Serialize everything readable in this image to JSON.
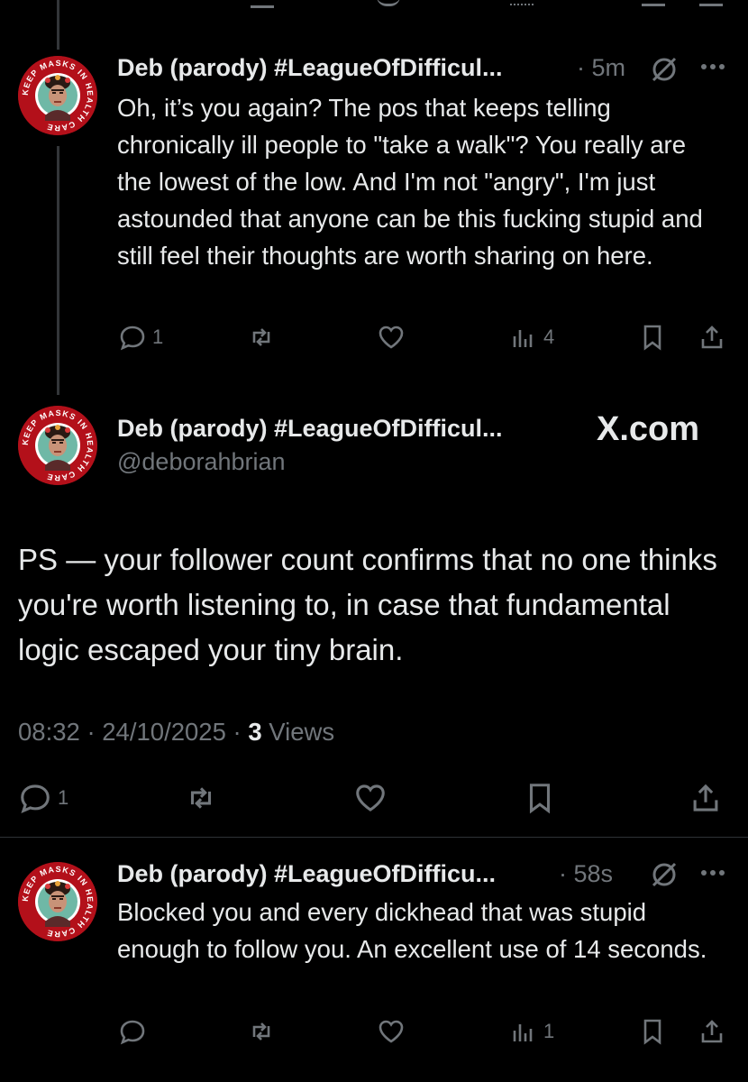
{
  "reply1": {
    "name": "Deb (parody) #LeagueOfDifficul...",
    "time": "· 5m",
    "text": "Oh, it’s you again? The pos that keeps telling chronically ill people to \"take a walk\"? You really are the lowest of the low. And I'm not \"angry\", I'm just astounded that anyone can be this fucking stupid and still feel their thoughts are worth sharing on here.",
    "reply_count": "1",
    "views_count": "4"
  },
  "main_post": {
    "name": "Deb (parody) #LeagueOfDifficul...",
    "handle": "@deborahbrian",
    "watermark": "X.com",
    "text": "PS — your follower count confirms that no one thinks you're worth listening to, in case that fundamental logic escaped your tiny brain.",
    "time": "08:32 · 24/10/2025 ·",
    "views_num": "3",
    "views_label": " Views",
    "reply_count": "1"
  },
  "reply2": {
    "name": "Deb (parody) #LeagueOfDifficu...",
    "time": "· 58s",
    "text": "Blocked you and every dickhead that was stupid enough to follow you. An excellent use of 14 seconds.",
    "views_count": "1"
  },
  "avatar": {
    "ring_text": "KEEP MASKS IN HEALTH CARE",
    "ring_color": "#b3101a"
  },
  "icons": [
    "reply-icon",
    "repost-icon",
    "like-icon",
    "views-icon",
    "bookmark-icon",
    "share-icon",
    "more-icon",
    "muted-icon"
  ],
  "colors": {
    "background": "#000000",
    "text": "#e7e9ea",
    "muted": "#71767b",
    "divider": "#2f3336"
  }
}
